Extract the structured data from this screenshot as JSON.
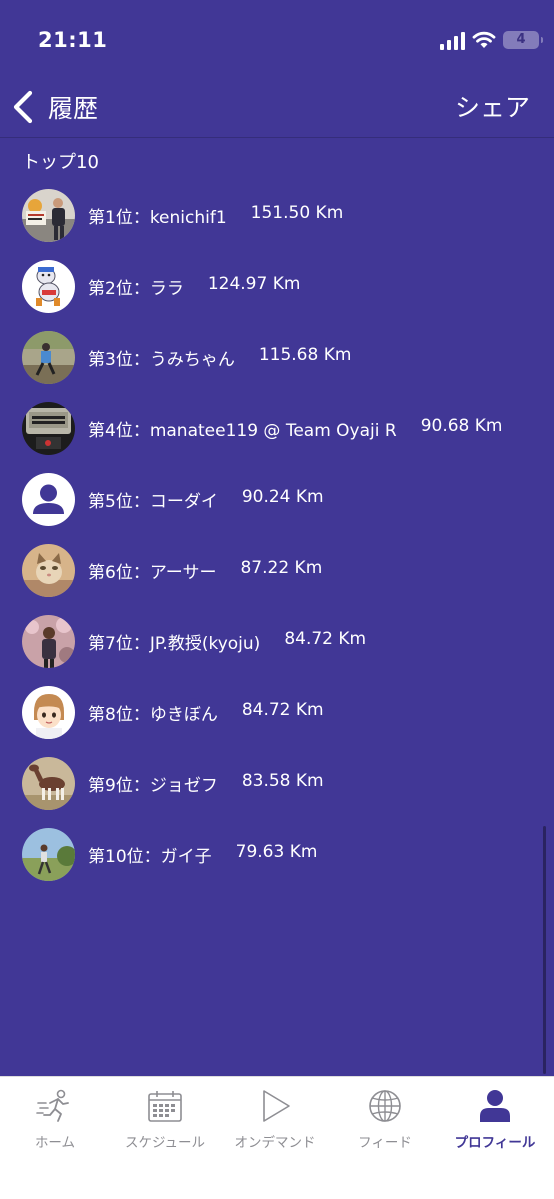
{
  "status_bar": {
    "time": "21:11",
    "battery": "4"
  },
  "nav": {
    "title": "履歴",
    "share_label": "シェア"
  },
  "section_title": "トップ10",
  "rankings": [
    {
      "label": "第1位：kenichif1",
      "distance": "151.50 Km",
      "avatar": "marathon-photo"
    },
    {
      "label": "第2位：ララ",
      "distance": "124.97 Km",
      "avatar": "cartoon-runner"
    },
    {
      "label": "第3位：うみちゃん",
      "distance": "115.68 Km",
      "avatar": "runner-photo"
    },
    {
      "label": "第4位：manatee119 @ Team Oyaji R",
      "distance": "90.68 Km",
      "avatar": "watch-photo"
    },
    {
      "label": "第5位：コーダイ",
      "distance": "90.24 Km",
      "avatar": "default-user"
    },
    {
      "label": "第6位：アーサー",
      "distance": "87.22 Km",
      "avatar": "cat-photo"
    },
    {
      "label": "第7位：JP.教授(kyoju)",
      "distance": "84.72 Km",
      "avatar": "blossom-photo"
    },
    {
      "label": "第8位：ゆきぼん",
      "distance": "84.72 Km",
      "avatar": "anime-face"
    },
    {
      "label": "第9位：ジョゼフ",
      "distance": "83.58 Km",
      "avatar": "horse-photo"
    },
    {
      "label": "第10位：ガイ子",
      "distance": "79.63 Km",
      "avatar": "field-photo"
    }
  ],
  "tabs": [
    {
      "label": "ホーム",
      "icon": "running-person-icon",
      "active": false
    },
    {
      "label": "スケジュール",
      "icon": "calendar-icon",
      "active": false
    },
    {
      "label": "オンデマンド",
      "icon": "play-icon",
      "active": false
    },
    {
      "label": "フィード",
      "icon": "globe-icon",
      "active": false
    },
    {
      "label": "プロフィール",
      "icon": "profile-icon",
      "active": true
    }
  ],
  "colors": {
    "background": "#413796",
    "accent": "#413796",
    "tab_inactive": "#8e8e93"
  }
}
